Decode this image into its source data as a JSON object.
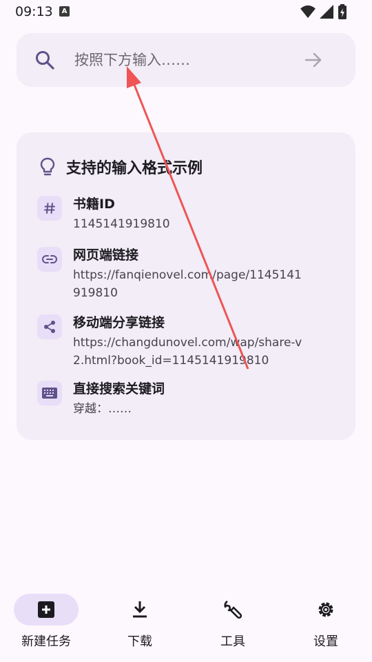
{
  "status_bar": {
    "time": "09:13",
    "notif_letter": "A"
  },
  "search": {
    "placeholder": "按照下方输入……"
  },
  "card": {
    "title": "支持的输入格式示例",
    "items": [
      {
        "title": "书籍ID",
        "desc": "1145141919810",
        "icon": "hash-icon"
      },
      {
        "title": "网页端链接",
        "desc": "https://fanqienovel.com/page/1145141919810",
        "icon": "link-icon"
      },
      {
        "title": "移动端分享链接",
        "desc": "https://changdunovel.com/wap/share-v2.html?book_id=1145141919810",
        "icon": "share-icon"
      },
      {
        "title": "直接搜索关键词",
        "desc": "穿越：……",
        "icon": "keyboard-icon"
      }
    ]
  },
  "nav": {
    "items": [
      {
        "label": "新建任务",
        "icon": "add-box-icon",
        "active": true
      },
      {
        "label": "下载",
        "icon": "download-icon",
        "active": false
      },
      {
        "label": "工具",
        "icon": "wrench-icon",
        "active": false
      },
      {
        "label": "设置",
        "icon": "gear-icon",
        "active": false
      }
    ]
  },
  "colors": {
    "accent": "#e8def8",
    "icon_primary": "#5e538a",
    "annotation": "#f05454"
  }
}
